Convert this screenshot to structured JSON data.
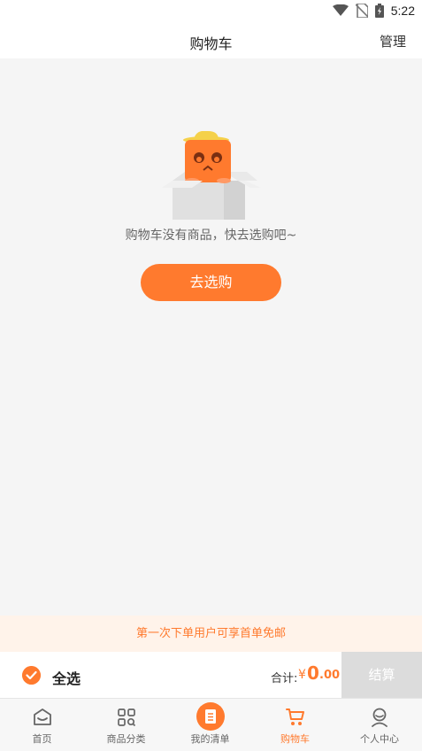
{
  "status_bar": {
    "time": "5:22"
  },
  "header": {
    "title": "购物车",
    "manage_label": "管理"
  },
  "empty_state": {
    "message": "购物车没有商品，快去选购吧~",
    "button_label": "去选购"
  },
  "promo": {
    "text": "第一次下单用户可享首单免邮"
  },
  "checkout": {
    "select_all_label": "全选",
    "total_label": "合计:",
    "currency": "¥",
    "total_integer": "0",
    "total_decimal": ".00",
    "checkout_label": "结算"
  },
  "tabbar": {
    "tabs": [
      {
        "label": "首页",
        "icon": "home-icon",
        "active": false
      },
      {
        "label": "商品分类",
        "icon": "category-grid-icon",
        "active": false
      },
      {
        "label": "我的清单",
        "icon": "list-icon",
        "active": false
      },
      {
        "label": "购物车",
        "icon": "cart-icon",
        "active": true
      },
      {
        "label": "个人中心",
        "icon": "user-icon",
        "active": false
      }
    ]
  },
  "colors": {
    "accent": "#ff7a2e",
    "background": "#f5f5f5",
    "promo_bg": "#fff3ea",
    "checkout_disabled": "#dcdcdc"
  }
}
